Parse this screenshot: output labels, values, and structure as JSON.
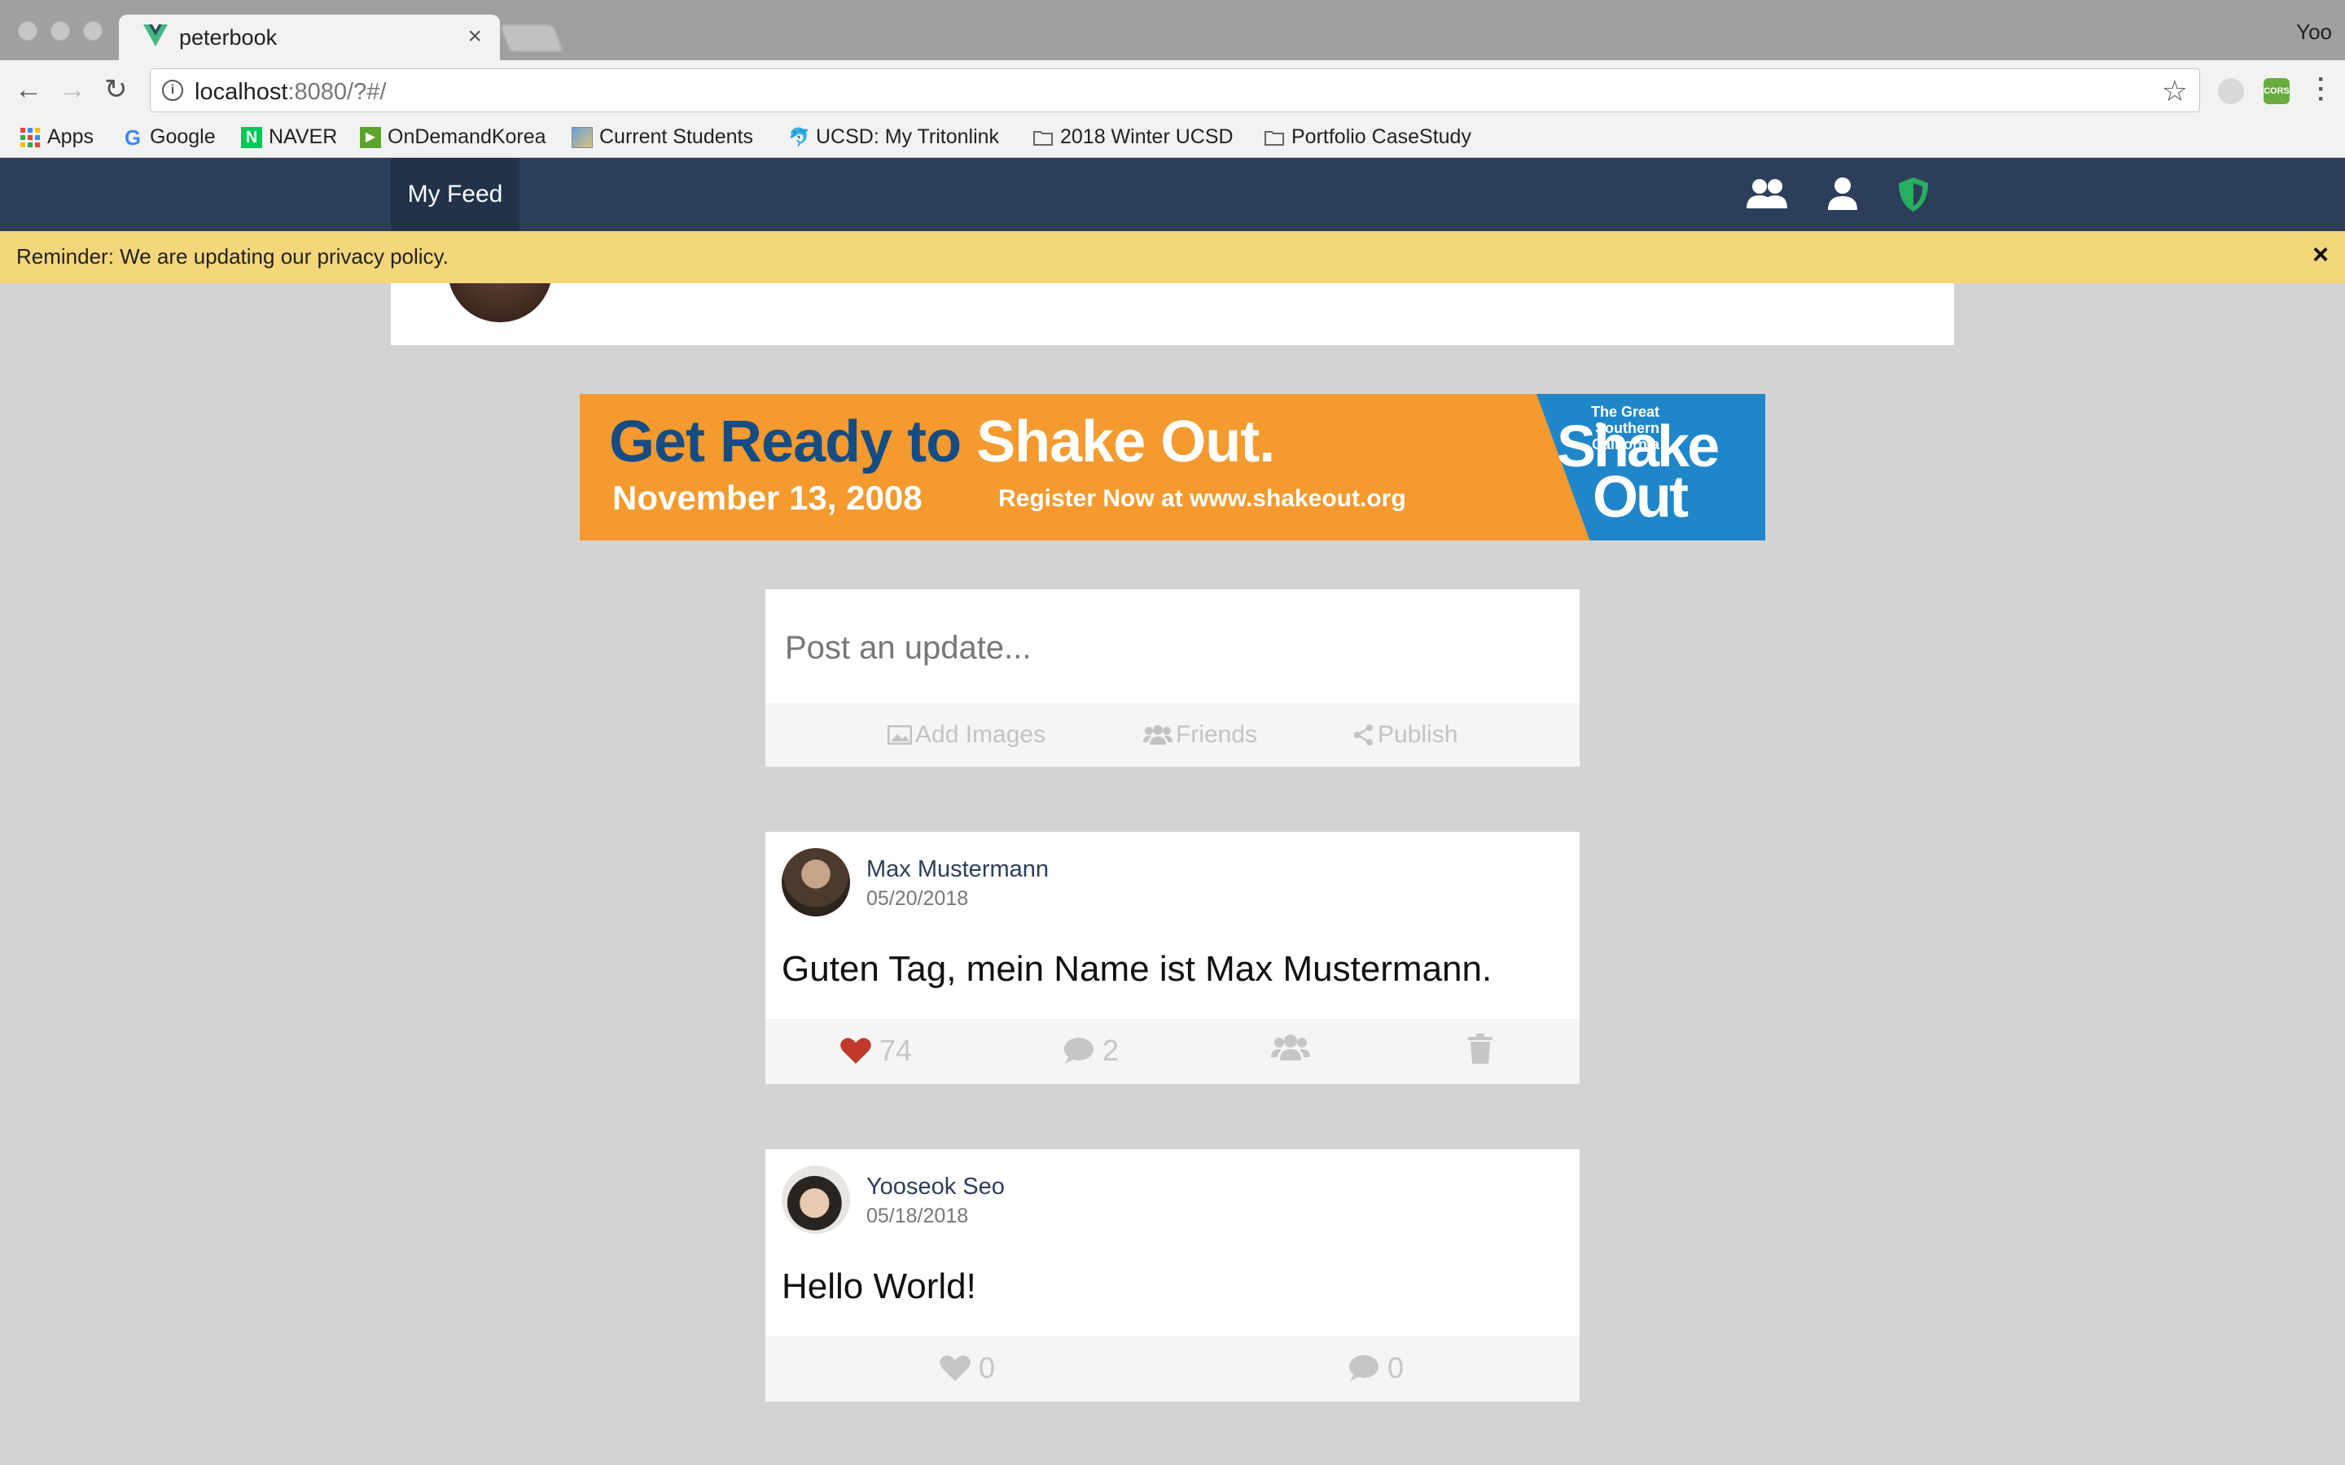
{
  "browser": {
    "tab_title": "peterbook",
    "tab_close": "×",
    "profile_name": "Yoo",
    "url_host": "localhost",
    "url_rest": ":8080/?#/",
    "bookmarks": [
      {
        "label": "Apps",
        "icon": "apps-grid-icon"
      },
      {
        "label": "Google",
        "icon": "google-icon"
      },
      {
        "label": "NAVER",
        "icon": "naver-icon"
      },
      {
        "label": "OnDemandKorea",
        "icon": "ondemandkorea-icon"
      },
      {
        "label": "Current Students",
        "icon": "current-students-icon"
      },
      {
        "label": "UCSD: My Tritonlink",
        "icon": "tritonlink-icon"
      },
      {
        "label": "2018 Winter UCSD",
        "icon": "folder-icon"
      },
      {
        "label": "Portfolio CaseStudy",
        "icon": "folder-icon"
      }
    ]
  },
  "app": {
    "nav_active": "My Feed",
    "nav_icons": [
      "friends-icon",
      "user-icon",
      "shield-icon"
    ],
    "banner_text": "Reminder: We are updating our privacy policy.",
    "banner_close": "×",
    "colors": {
      "nav_bg": "#2c3e5a",
      "banner_bg": "#f4d67b",
      "heart": "#c0392b",
      "shield": "#27ae60"
    }
  },
  "ad": {
    "line1_a": "Get Ready to ",
    "line1_b": "Shake Out.",
    "date": "November 13, 2008",
    "register": "Register Now at www.shakeout.org",
    "logo_small": "The Great Southern California",
    "logo_big_1": "Shake",
    "logo_big_2": "Out"
  },
  "composer": {
    "placeholder": "Post an update...",
    "buttons": [
      {
        "label": "Add Images",
        "icon": "image-icon"
      },
      {
        "label": "Friends",
        "icon": "friends-icon"
      },
      {
        "label": "Publish",
        "icon": "share-icon"
      }
    ]
  },
  "posts": [
    {
      "author": "Max Mustermann",
      "date": "05/20/2018",
      "text": "Guten Tag, mein Name ist Max Mustermann.",
      "likes": "74",
      "comments": "2",
      "liked": true
    },
    {
      "author": "Yooseok Seo",
      "date": "05/18/2018",
      "text": "Hello World!",
      "likes": "0",
      "comments": "0",
      "liked": false
    }
  ]
}
